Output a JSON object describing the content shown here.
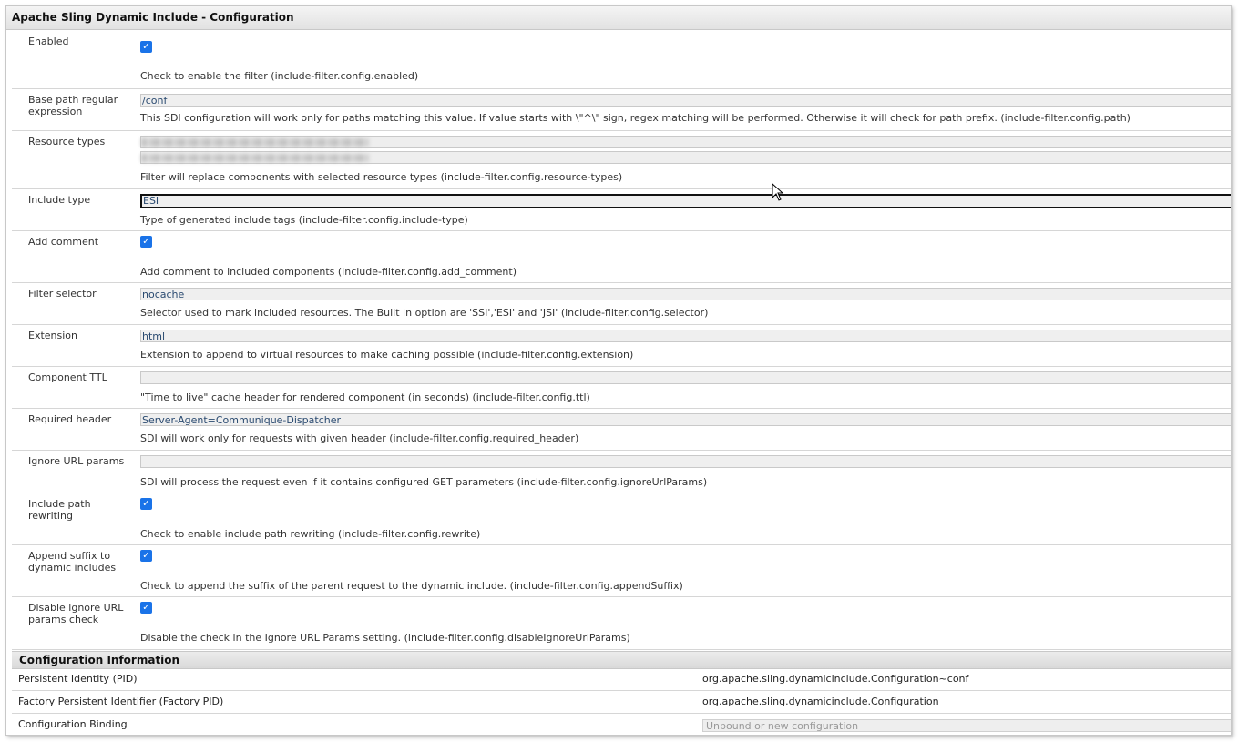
{
  "title": "Apache Sling Dynamic Include - Configuration",
  "fields": {
    "enabled": {
      "label": "Enabled",
      "checked": true,
      "desc": "Check to enable the filter (include-filter.config.enabled)"
    },
    "base_path": {
      "label": "Base path regular expression",
      "value": "/conf",
      "desc": "This SDI configuration will work only for paths matching this value. If value starts with \\\"^\\\" sign, regex matching will be performed. Otherwise it will check for path prefix. (include-filter.config.path)"
    },
    "resource_types": {
      "label": "Resource types",
      "desc": "Filter will replace components with selected resource types (include-filter.config.resource-types)"
    },
    "include_type": {
      "label": "Include type",
      "value": "ESI",
      "desc": "Type of generated include tags (include-filter.config.include-type)"
    },
    "add_comment": {
      "label": "Add comment",
      "checked": true,
      "desc": "Add comment to included components (include-filter.config.add_comment)"
    },
    "filter_selector": {
      "label": "Filter selector",
      "value": "nocache",
      "desc": "Selector used to mark included resources. The Built in option are 'SSI','ESI' and 'JSI' (include-filter.config.selector)"
    },
    "extension": {
      "label": "Extension",
      "value": "html",
      "desc": "Extension to append to virtual resources to make caching possible (include-filter.config.extension)"
    },
    "component_ttl": {
      "label": "Component TTL",
      "value": "",
      "desc": "\"Time to live\" cache header for rendered component (in seconds) (include-filter.config.ttl)"
    },
    "required_header": {
      "label": "Required header",
      "value": "Server-Agent=Communique-Dispatcher",
      "desc": "SDI will work only for requests with given header (include-filter.config.required_header)"
    },
    "ignore_url_params": {
      "label": "Ignore URL params",
      "value": "",
      "desc": "SDI will process the request even if it contains configured GET parameters (include-filter.config.ignoreUrlParams)"
    },
    "path_rewriting": {
      "label": "Include path rewriting",
      "checked": true,
      "desc": "Check to enable include path rewriting (include-filter.config.rewrite)"
    },
    "append_suffix": {
      "label": "Append suffix to dynamic includes",
      "checked": true,
      "desc": "Check to append the suffix of the parent request to the dynamic include. (include-filter.config.appendSuffix)"
    },
    "disable_ignore": {
      "label": "Disable ignore URL params check",
      "checked": true,
      "desc": "Disable the check in the Ignore URL Params setting. (include-filter.config.disableIgnoreUrlParams)"
    }
  },
  "config_info": {
    "title": "Configuration Information",
    "pid_label": "Persistent Identity (PID)",
    "pid_value": "org.apache.sling.dynamicinclude.Configuration~conf",
    "factory_label": "Factory Persistent Identifier (Factory PID)",
    "factory_value": "org.apache.sling.dynamicinclude.Configuration",
    "binding_label": "Configuration Binding",
    "binding_placeholder": "Unbound or new configuration"
  },
  "check_glyph": "✓",
  "icons": {
    "checkbox": "checkmark-icon",
    "pointer": "mouse-cursor-icon"
  },
  "colors": {
    "checkbox": "#1a73e8",
    "field_bg": "#efefef",
    "field_text": "#2a4a70"
  }
}
